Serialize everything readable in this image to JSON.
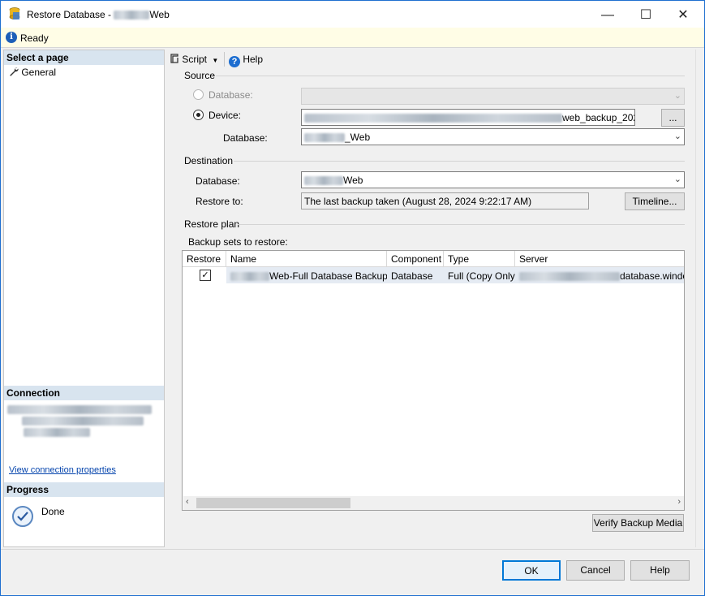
{
  "window": {
    "title_prefix": "Restore Database - ",
    "title_suffix": "Web",
    "minimize": "—",
    "maximize": "☐",
    "close": "✕"
  },
  "status": {
    "text": "Ready",
    "icon": "info-icon"
  },
  "left": {
    "select_page": "Select a page",
    "pages": [
      "General"
    ],
    "connection_heading": "Connection",
    "view_connection_link": "View connection properties",
    "progress_heading": "Progress",
    "progress_status": "Done"
  },
  "toolbar": {
    "script": "Script",
    "help": "Help"
  },
  "source": {
    "heading": "Source",
    "database_radio": "Database:",
    "device_radio": "Device:",
    "device_path_visible": "web_backup_202",
    "browse_button": "...",
    "database_label": "Database:",
    "database_value": "_Web"
  },
  "destination": {
    "heading": "Destination",
    "database_label": "Database:",
    "database_value": "Web",
    "restore_to_label": "Restore to:",
    "restore_to_value": "The last backup taken (August 28, 2024 9:22:17 AM)",
    "timeline_button": "Timeline..."
  },
  "restore_plan": {
    "heading": "Restore plan",
    "backup_sets_label": "Backup sets to restore:",
    "columns": [
      "Restore",
      "Name",
      "Component",
      "Type",
      "Server"
    ],
    "rows": [
      {
        "restore": true,
        "name": "Web-Full Database Backup",
        "component": "Database",
        "type": "Full (Copy Only)",
        "server": "database.windo"
      }
    ],
    "verify_button": "Verify Backup Media"
  },
  "buttons": {
    "ok": "OK",
    "cancel": "Cancel",
    "help": "Help"
  }
}
